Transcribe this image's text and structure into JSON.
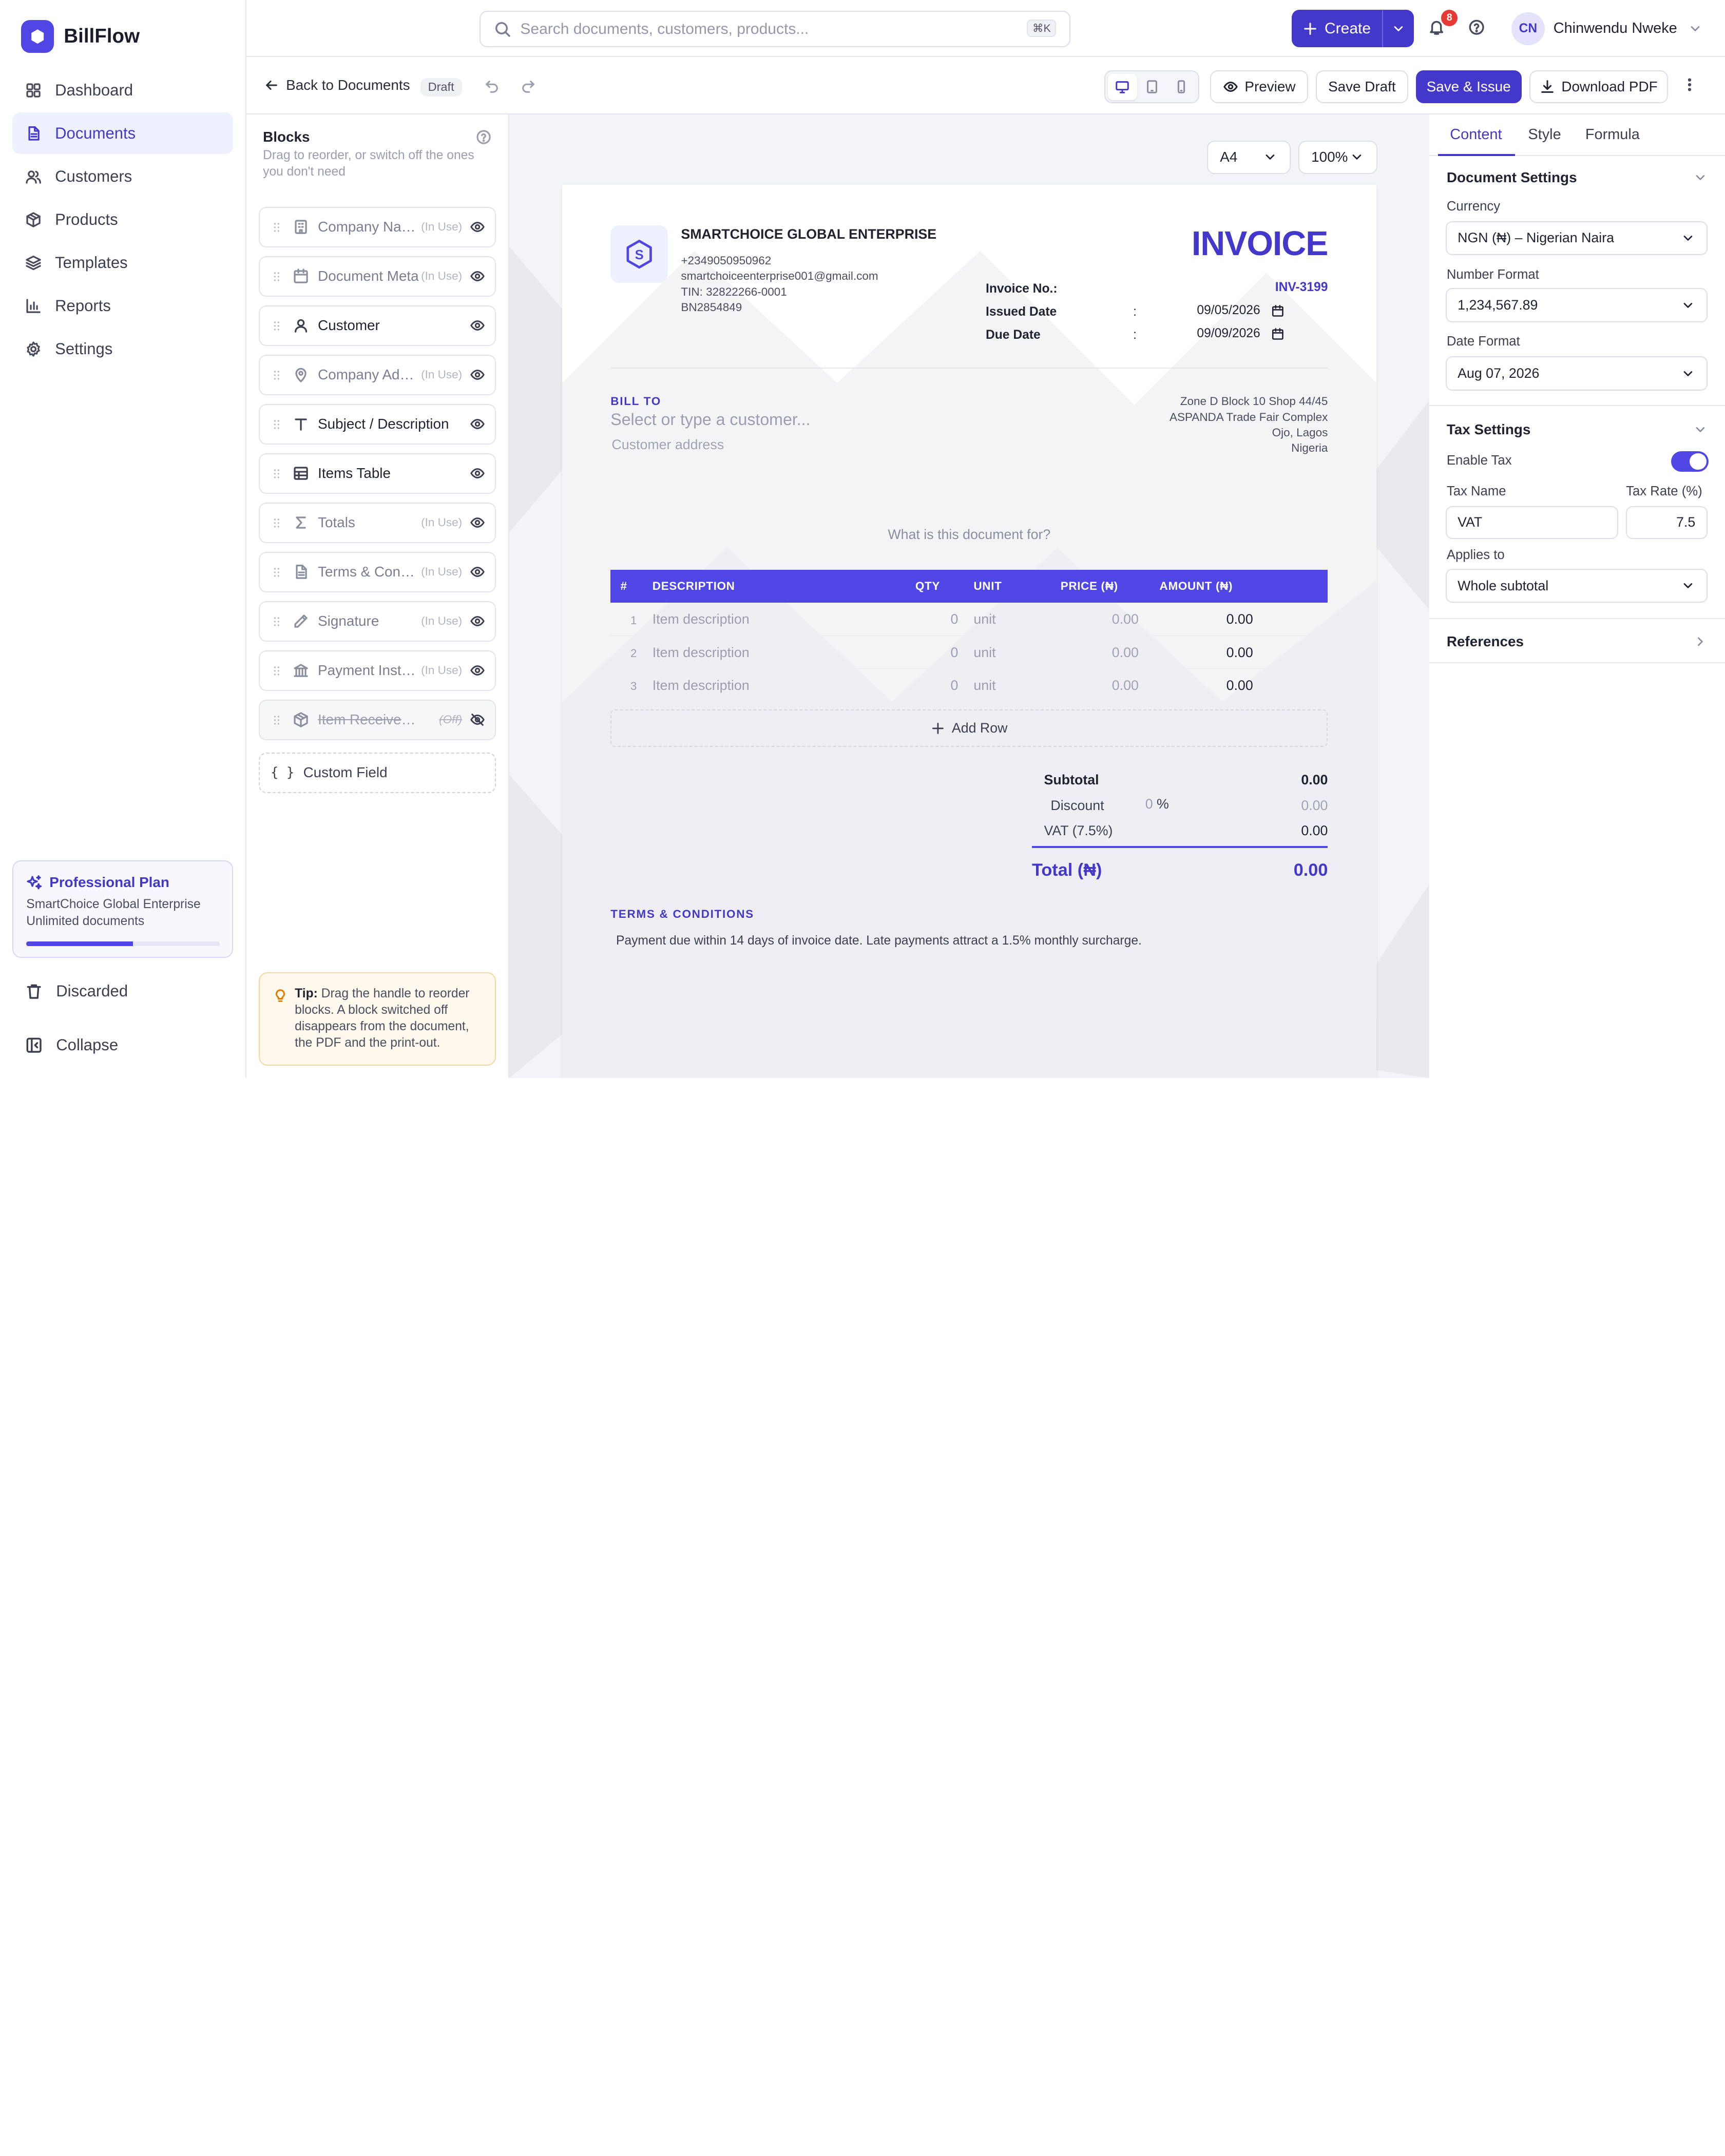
{
  "app": {
    "name": "BillFlow"
  },
  "sidebar": {
    "items": [
      {
        "label": "Dashboard",
        "icon": "dashboard-icon"
      },
      {
        "label": "Documents",
        "icon": "document-icon",
        "active": true
      },
      {
        "label": "Customers",
        "icon": "users-icon"
      },
      {
        "label": "Products",
        "icon": "box-icon"
      },
      {
        "label": "Templates",
        "icon": "layers-icon"
      },
      {
        "label": "Reports",
        "icon": "bar-chart-icon"
      },
      {
        "label": "Settings",
        "icon": "gear-icon"
      }
    ],
    "plan": {
      "title": "Professional Plan",
      "company": "SmartChoice Global Enterprise",
      "docs": "Unlimited documents",
      "usage": 0.55
    },
    "discarded": "Discarded",
    "collapse": "Collapse"
  },
  "topbar": {
    "search_placeholder": "Search documents, customers, products...",
    "shortcut": "⌘K",
    "create_label": "Create",
    "notifications": "8",
    "user_initials": "CN",
    "user_name": "Chinwendu Nweke"
  },
  "toolbar": {
    "back_label": "Back to Documents",
    "status": "Draft",
    "preview": "Preview",
    "save_draft": "Save Draft",
    "save_issue": "Save & Issue",
    "download": "Download PDF"
  },
  "blocks": {
    "title": "Blocks",
    "subtitle": "Drag to reorder, or switch off the ones you don't need",
    "items": [
      {
        "label": "Company Name",
        "status": "(In Use)",
        "icon": "building-icon"
      },
      {
        "label": "Document Meta",
        "status": "(In Use)",
        "icon": "calendar-icon"
      },
      {
        "label": "Customer",
        "status": "",
        "icon": "user-icon"
      },
      {
        "label": "Company Address",
        "status": "(In Use)",
        "icon": "map-pin-icon"
      },
      {
        "label": "Subject / Description",
        "status": "",
        "icon": "text-icon"
      },
      {
        "label": "Items Table",
        "status": "",
        "icon": "table-icon"
      },
      {
        "label": "Totals",
        "status": "(In Use)",
        "icon": "sigma-icon"
      },
      {
        "label": "Terms & Conditions",
        "status": "(In Use)",
        "icon": "file-text-icon"
      },
      {
        "label": "Signature",
        "status": "(In Use)",
        "icon": "pen-icon"
      },
      {
        "label": "Payment Instructions",
        "status": "(In Use)",
        "icon": "bank-icon"
      },
      {
        "label": "Item Received By",
        "status": "(Off)",
        "icon": "package-icon",
        "off": true
      }
    ],
    "custom_field": "Custom Field",
    "tip_label": "Tip:",
    "tip_text": " Drag the handle to reorder blocks. A block switched off disappears from the document, the PDF and the print-out."
  },
  "canvas": {
    "page_size": "A4",
    "zoom": "100%"
  },
  "invoice": {
    "company_name": "SMARTCHOICE GLOBAL ENTERPRISE",
    "company_initial": "S",
    "phone": "+2349050950962",
    "email": "smartchoiceenterprise001@gmail.com",
    "tin": "TIN: 32822266-0001",
    "bn": "BN2854849",
    "title": "INVOICE",
    "number_label": "Invoice No.:",
    "number": "INV-3199",
    "issued_label": "Issued Date",
    "issued": "09/05/2026",
    "due_label": "Due Date",
    "due": "09/09/2026",
    "colon": ":",
    "bill_to": "BILL TO",
    "customer_placeholder": "Select or type a customer...",
    "address_placeholder": "Customer address",
    "company_address": [
      "Zone D Block 10 Shop 44/45",
      "ASPANDA Trade Fair Complex",
      "Ojo, Lagos",
      "Nigeria"
    ],
    "subject_placeholder": "What is this document for?",
    "columns": {
      "num": "#",
      "desc": "DESCRIPTION",
      "qty": "QTY",
      "unit": "UNIT",
      "price": "PRICE (₦)",
      "amount": "AMOUNT (₦)"
    },
    "rows": [
      {
        "num": "1",
        "desc": "Item description",
        "qty": "0",
        "unit": "unit",
        "price": "0.00",
        "amount": "0.00"
      },
      {
        "num": "2",
        "desc": "Item description",
        "qty": "0",
        "unit": "unit",
        "price": "0.00",
        "amount": "0.00"
      },
      {
        "num": "3",
        "desc": "Item description",
        "qty": "0",
        "unit": "unit",
        "price": "0.00",
        "amount": "0.00"
      }
    ],
    "add_row": "Add Row",
    "subtotal_label": "Subtotal",
    "subtotal": "0.00",
    "discount_label": "Discount",
    "discount_pct": "0",
    "pct_sign": "%",
    "discount": "0.00",
    "vat_label": "VAT (7.5%)",
    "vat": "0.00",
    "total_label": "Total (₦)",
    "total": "0.00",
    "terms_title": "TERMS & CONDITIONS",
    "terms_text": "Payment due within 14 days of invoice date. Late payments attract a 1.5% monthly surcharge."
  },
  "settings": {
    "tabs": [
      "Content",
      "Style",
      "Formula"
    ],
    "doc_settings": "Document Settings",
    "currency_label": "Currency",
    "currency": "NGN (₦) – Nigerian Naira",
    "number_format_label": "Number Format",
    "number_format": "1,234,567.89",
    "date_format_label": "Date Format",
    "date_format": "Aug 07, 2026",
    "tax_settings": "Tax Settings",
    "enable_tax_label": "Enable Tax",
    "enable_tax": true,
    "tax_name_label": "Tax Name",
    "tax_name": "VAT",
    "tax_rate_label": "Tax Rate (%)",
    "tax_rate": "7.5",
    "applies_to_label": "Applies to",
    "applies_to": "Whole subtotal",
    "references": "References"
  },
  "colors": {
    "accent": "#4338ca",
    "table_header": "#4f46e5",
    "badge": "#e53935"
  }
}
